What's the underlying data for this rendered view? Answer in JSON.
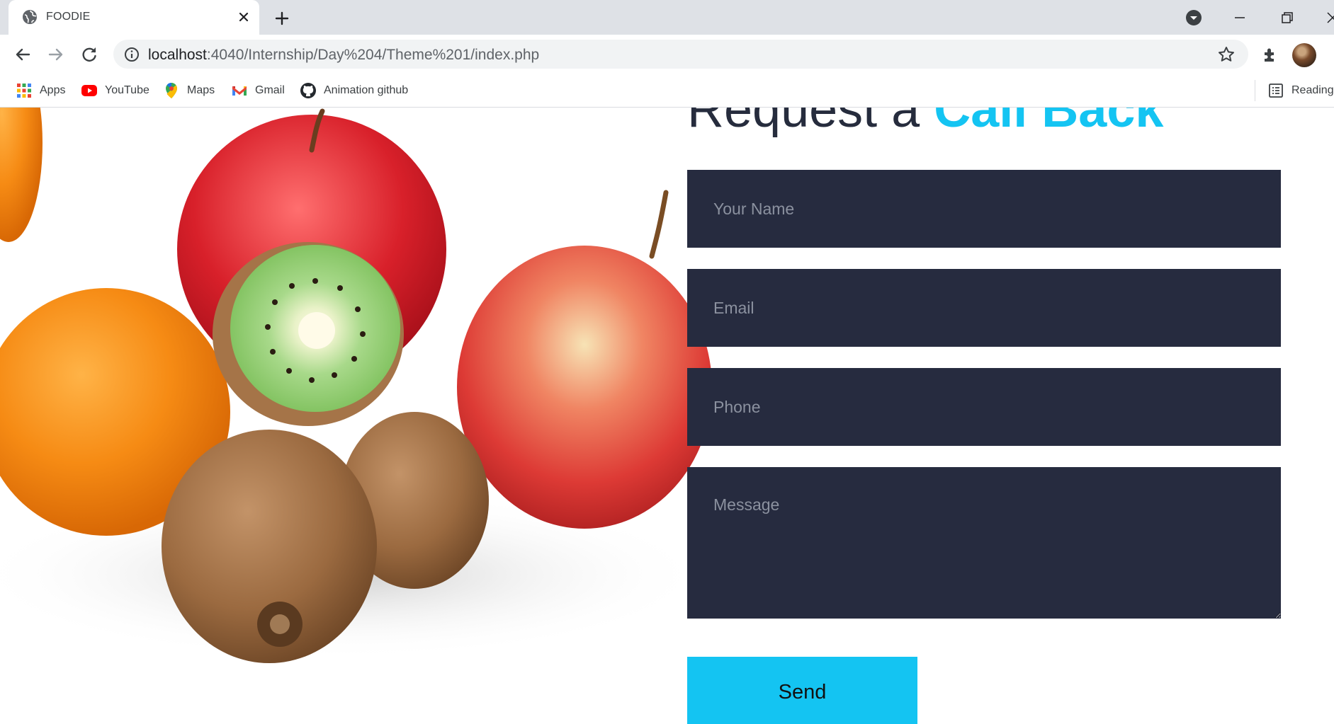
{
  "browser": {
    "tab": {
      "title": "FOODIE",
      "favicon": "globe-icon"
    },
    "address": {
      "host": "localhost",
      "path": ":4040/Internship/Day%204/Theme%201/index.php"
    },
    "bookmarks": [
      {
        "label": "Apps",
        "icon": "apps-grid-icon"
      },
      {
        "label": "YouTube",
        "icon": "youtube-icon"
      },
      {
        "label": "Maps",
        "icon": "maps-pin-icon"
      },
      {
        "label": "Gmail",
        "icon": "gmail-icon"
      },
      {
        "label": "Animation github",
        "icon": "github-icon"
      }
    ],
    "reading_list": "Reading list"
  },
  "page": {
    "heading": {
      "prefix": "Request a ",
      "accent": "Call Back"
    },
    "form": {
      "name_placeholder": "Your Name",
      "email_placeholder": "Email",
      "phone_placeholder": "Phone",
      "message_placeholder": "Message",
      "send_label": "Send"
    }
  },
  "colors": {
    "accent": "#14c4f2",
    "field_background": "#262b3f",
    "heading_text": "#262c3d",
    "tab_strip": "#dee1e6"
  }
}
